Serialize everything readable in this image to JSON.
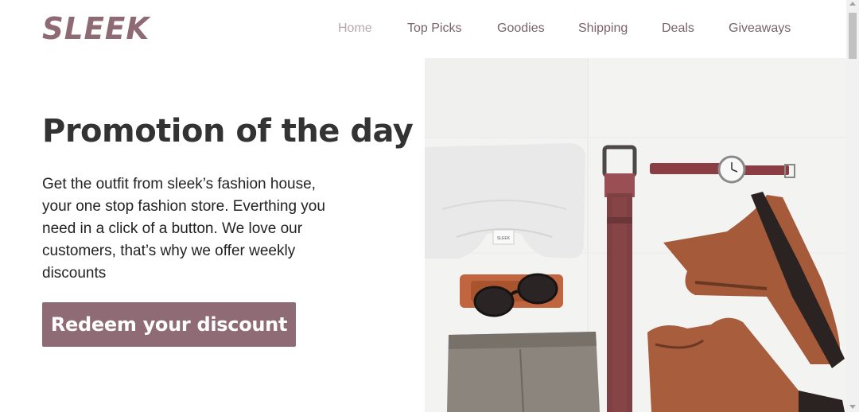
{
  "brand": {
    "logo_text": "SLEEK",
    "accent_color": "#8e6b74"
  },
  "nav": {
    "items": [
      {
        "label": "Home",
        "active": true
      },
      {
        "label": "Top Picks",
        "active": false
      },
      {
        "label": "Goodies",
        "active": false
      },
      {
        "label": "Shipping",
        "active": false
      },
      {
        "label": "Deals",
        "active": false
      },
      {
        "label": "Giveaways",
        "active": false
      }
    ]
  },
  "hero": {
    "title": "Promotion of the day",
    "description": "Get the outfit from sleek’s fashion house, your one stop fashion store. Everthing you need in a click of a button. We love our customers, that’s why we offer weekly discounts",
    "cta_label": "Redeem your discount",
    "cta_color": "#8f6b75",
    "shirt_tag_text": "SLEEK"
  }
}
